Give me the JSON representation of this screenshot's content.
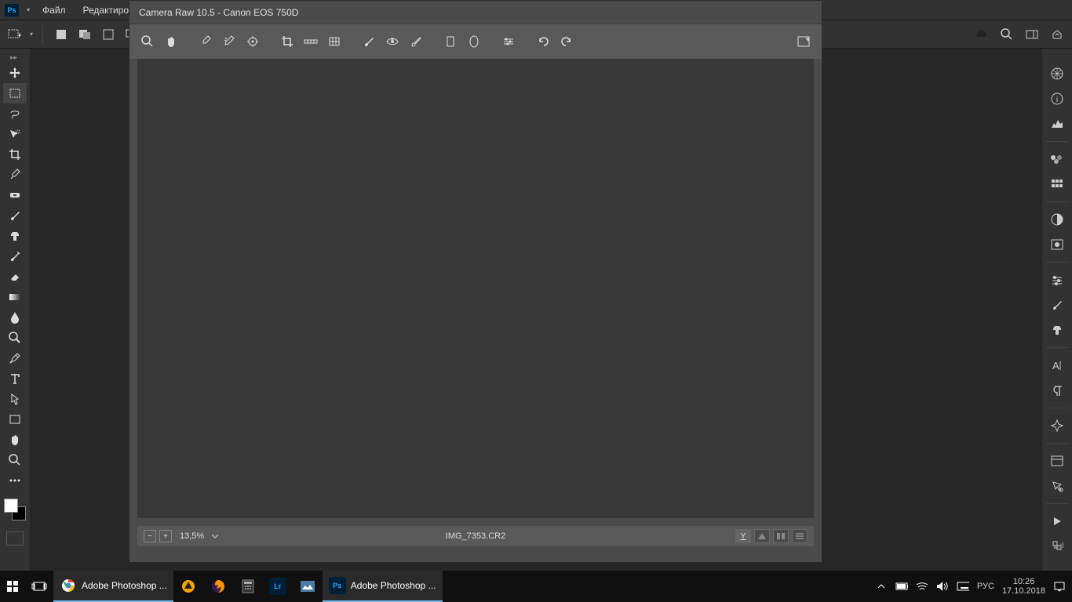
{
  "menubar": {
    "app_short": "Ps",
    "items": [
      "Файл",
      "Редактирован"
    ]
  },
  "options_bar": {
    "tools": [
      "marquee-dd",
      "fill-square",
      "copy-layer",
      "paste-layer",
      "merge-layer"
    ]
  },
  "left_tools": {
    "items": [
      "move",
      "marquee",
      "lasso",
      "magic-wand",
      "crop",
      "eyedropper",
      "healing",
      "brush",
      "clone",
      "history-brush",
      "eraser",
      "gradient",
      "blur",
      "dodge",
      "pen",
      "type",
      "path-select",
      "rectangle",
      "hand",
      "zoom",
      "more"
    ]
  },
  "right_tools": {
    "items": [
      "color-wheel",
      "info",
      "histogram",
      "swatches1",
      "swatches2",
      "adjustment",
      "mask",
      "brushes",
      "brush-settings",
      "clone-source",
      "character",
      "paragraph",
      "navigator",
      "options",
      "tool-presets",
      "actions",
      "history"
    ]
  },
  "camera_raw": {
    "title": "Camera Raw 10.5  -  Canon EOS 750D",
    "tools": [
      "zoom",
      "hand",
      "white-balance",
      "color-sampler",
      "target-adjust",
      "crop",
      "straighten",
      "transform",
      "spot-removal",
      "red-eye",
      "adjustment-brush",
      "graduated-filter",
      "radial-filter",
      "preferences",
      "rotate-left",
      "rotate-right"
    ],
    "zoom": "13,5%",
    "filename": "IMG_7353.CR2",
    "preview_letter": "Y"
  },
  "taskbar": {
    "items": [
      {
        "icon": "start",
        "label": ""
      },
      {
        "icon": "task-view",
        "label": ""
      },
      {
        "icon": "chrome",
        "label": "Adobe Photoshop ..."
      },
      {
        "icon": "aimp",
        "label": ""
      },
      {
        "icon": "firefox",
        "label": ""
      },
      {
        "icon": "calculator",
        "label": ""
      },
      {
        "icon": "lightroom",
        "label": ""
      },
      {
        "icon": "gallery",
        "label": ""
      },
      {
        "icon": "photoshop",
        "label": "Adobe Photoshop ..."
      }
    ],
    "lang": "РУС",
    "time": "10:26",
    "date": "17.10.2018"
  }
}
